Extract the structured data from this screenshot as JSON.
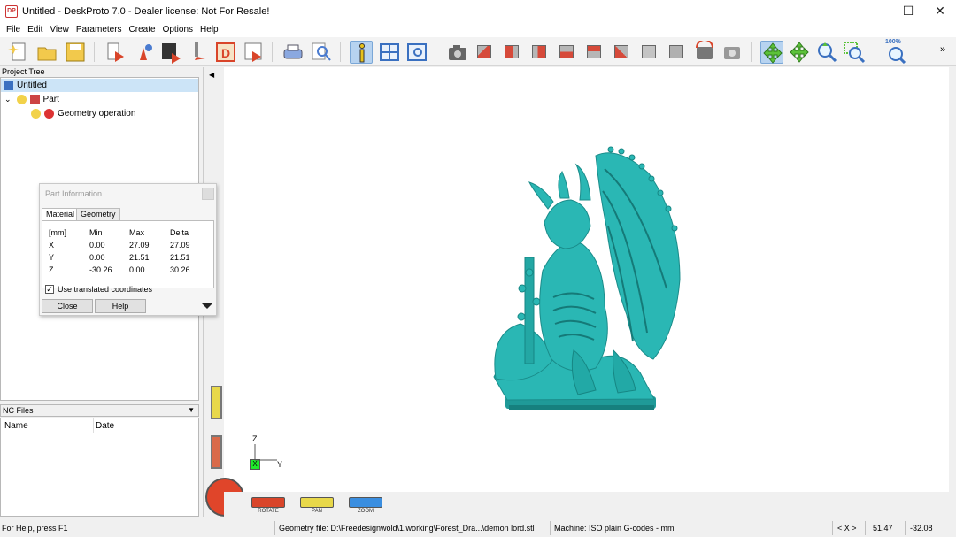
{
  "window": {
    "app_icon": "DP",
    "title": "Untitled - DeskProto 7.0 - Dealer license: Not For Resale!",
    "minimize": "—",
    "maximize": "☐",
    "close": "✕"
  },
  "menu": [
    "File",
    "Edit",
    "View",
    "Parameters",
    "Create",
    "Options",
    "Help"
  ],
  "toolbar": {
    "zoom_label": "100%",
    "more": "»",
    "icons": [
      "new-file-icon",
      "open-folder-icon",
      "save-icon",
      "import-part-icon",
      "part-wizard-icon",
      "image-wizard-icon",
      "tool-icon",
      "drawing-icon",
      "export-icon",
      "print-preview-icon",
      "magnifier-icon",
      "info-icon",
      "window-layout-icon",
      "view-window-icon",
      "camera-icon",
      "view-cube-red-icon",
      "view-cube-front-icon",
      "view-cube-side-icon",
      "view-cube-back-icon",
      "view-cube-top-icon",
      "view-cube-bottom-icon",
      "view-cube-iso-icon",
      "view-cube-gray-icon",
      "rotate-view-icon",
      "view-redraw-icon",
      "pan-icon",
      "move-icon",
      "zoom-in-icon",
      "zoom-window-icon",
      "zoom-fit-icon"
    ]
  },
  "project_tree": {
    "title": "Project Tree",
    "root": "Untitled",
    "part": "Part",
    "operation": "Geometry operation"
  },
  "nc_files": {
    "title": "NC Files",
    "columns": [
      "Name",
      "Date"
    ]
  },
  "part_info": {
    "title": "Part Information",
    "tabs": [
      "Material",
      "Geometry"
    ],
    "headers": [
      "[mm]",
      "Min",
      "Max",
      "Delta"
    ],
    "rows": [
      [
        "X",
        "0.00",
        "27.09",
        "27.09"
      ],
      [
        "Y",
        "0.00",
        "21.51",
        "21.51"
      ],
      [
        "Z",
        "-30.26",
        "0.00",
        "30.26"
      ]
    ],
    "checkbox_label": "Use translated coordinates",
    "checkbox_checked": true,
    "close_label": "Close",
    "help_label": "Help"
  },
  "viewport": {
    "axis_z": "Z",
    "axis_y": "Y",
    "axis_x": "X",
    "model_color": "#2ab7b4",
    "controls": [
      "ROTATE",
      "PAN",
      "ZOOM"
    ]
  },
  "status": {
    "help": "For Help, press F1",
    "geometry": "Geometry file: D:\\Freedesignwold\\1.working\\Forest_Dra...\\demon lord.stl",
    "machine": "Machine: ISO plain G-codes - mm",
    "axis": "< X >",
    "coord1": "51.47",
    "coord2": "-32.08"
  }
}
